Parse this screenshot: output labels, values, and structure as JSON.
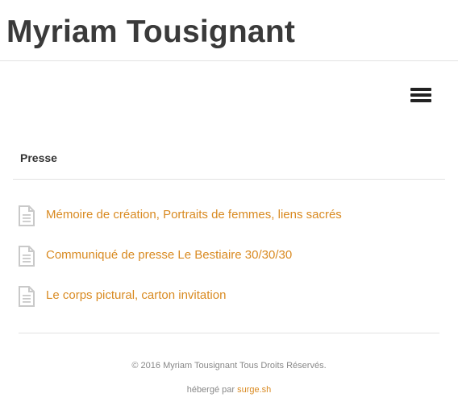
{
  "header": {
    "site_title": "Myriam Tousignant"
  },
  "nav": {
    "menu_icon": "hamburger-menu-icon"
  },
  "section": {
    "title": "Presse"
  },
  "documents": [
    {
      "icon": "document-icon",
      "label": "Mémoire de création, Portraits de femmes, liens sacrés"
    },
    {
      "icon": "document-icon",
      "label": "Communiqué de presse Le Bestiaire 30/30/30"
    },
    {
      "icon": "document-icon",
      "label": "Le corps pictural, carton invitation"
    }
  ],
  "footer": {
    "copyright": "© 2016 Myriam Tousignant Tous Droits Réservés.",
    "hosted_prefix": "hébergé par",
    "hosted_link": "surge.sh"
  },
  "colors": {
    "link": "#d98a21",
    "title": "#3a3a3a",
    "rule": "#e2e2e2",
    "muted": "#888888"
  }
}
